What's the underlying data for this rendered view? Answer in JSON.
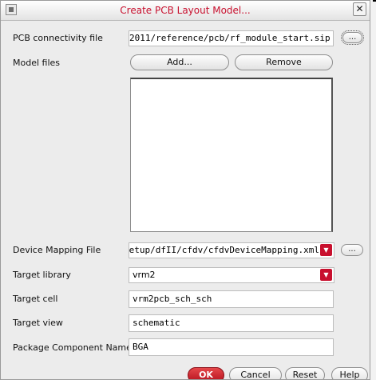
{
  "window": {
    "title": "Create PCB Layout Model...",
    "close_glyph": "✕",
    "icon": "window-menu-icon"
  },
  "form": {
    "pcb_connectivity": {
      "label": "PCB connectivity file",
      "value": "2011/reference/pcb/rf_module_start.sip",
      "browse_label": "..."
    },
    "model_files": {
      "label": "Model files",
      "add_label": "Add...",
      "remove_label": "Remove",
      "items": []
    },
    "device_mapping": {
      "label": "Device Mapping File",
      "value": "etup/dfII/cfdv/cfdvDeviceMapping.xml",
      "browse_label": "...",
      "dropdown_icon": "dropdown-arrow-icon"
    },
    "target_library": {
      "label": "Target library",
      "value": "vrm2",
      "dropdown_icon": "dropdown-arrow-icon"
    },
    "target_cell": {
      "label": "Target cell",
      "value": "vrm2pcb_sch_sch"
    },
    "target_view": {
      "label": "Target view",
      "value": "schematic"
    },
    "package_component": {
      "label": "Package Component Name",
      "value": "BGA"
    }
  },
  "buttons": {
    "ok": "OK",
    "cancel": "Cancel",
    "reset": "Reset",
    "help": "Help"
  },
  "colors": {
    "title_text": "#c8102e",
    "accent": "#c8102e",
    "dialog_bg": "#ececec"
  }
}
